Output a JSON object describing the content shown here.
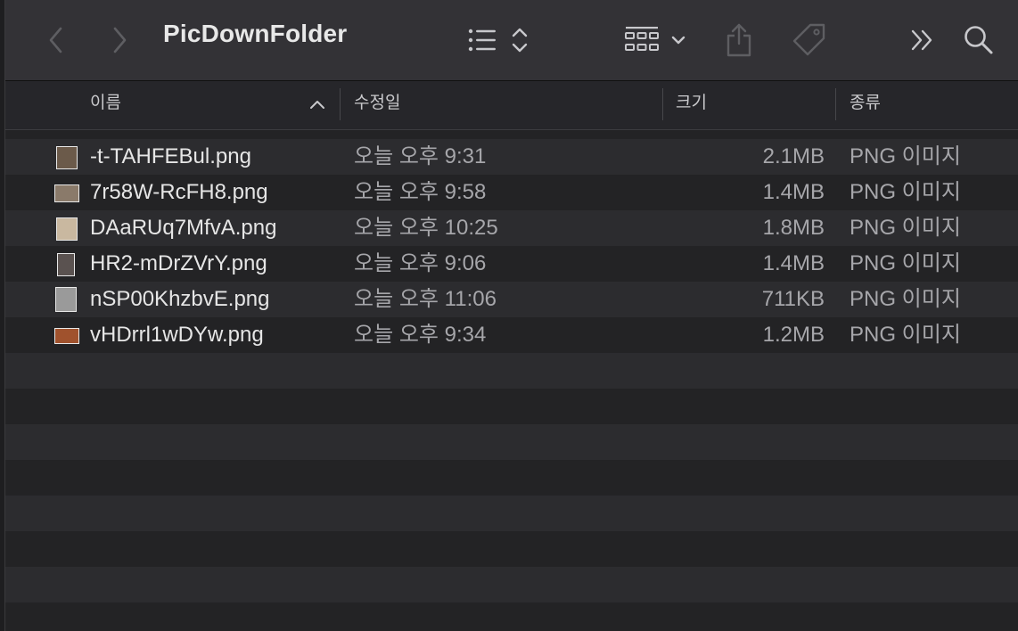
{
  "window": {
    "title": "PicDownFolder"
  },
  "toolbar": {
    "back": "chevron-left-icon",
    "forward": "chevron-right-icon",
    "view": "list-view-icon",
    "group": "grid-group-icon",
    "share": "share-icon",
    "tag": "tag-icon",
    "more": "double-chevron-icon",
    "search": "search-icon"
  },
  "columns": {
    "name": "이름",
    "date": "수정일",
    "size": "크기",
    "kind": "종류"
  },
  "files": [
    {
      "name": "-t-TAHFEBul.png",
      "date": "오늘 오후 9:31",
      "size": "2.1MB",
      "kind": "PNG 이미지",
      "thumb_color": "#6b5a4a"
    },
    {
      "name": "7r58W-RcFH8.png",
      "date": "오늘 오후 9:58",
      "size": "1.4MB",
      "kind": "PNG 이미지",
      "thumb_color": "#8a7a6a"
    },
    {
      "name": "DAaRUq7MfvA.png",
      "date": "오늘 오후 10:25",
      "size": "1.8MB",
      "kind": "PNG 이미지",
      "thumb_color": "#c9b8a0"
    },
    {
      "name": "HR2-mDrZVrY.png",
      "date": "오늘 오후 9:06",
      "size": "1.4MB",
      "kind": "PNG 이미지",
      "thumb_color": "#5a5250"
    },
    {
      "name": "nSP00KhzbvE.png",
      "date": "오늘 오후 11:06",
      "size": "711KB",
      "kind": "PNG 이미지",
      "thumb_color": "#9a9a9a"
    },
    {
      "name": "vHDrrl1wDYw.png",
      "date": "오늘 오후 9:34",
      "size": "1.2MB",
      "kind": "PNG 이미지",
      "thumb_color": "#a0522d"
    }
  ]
}
